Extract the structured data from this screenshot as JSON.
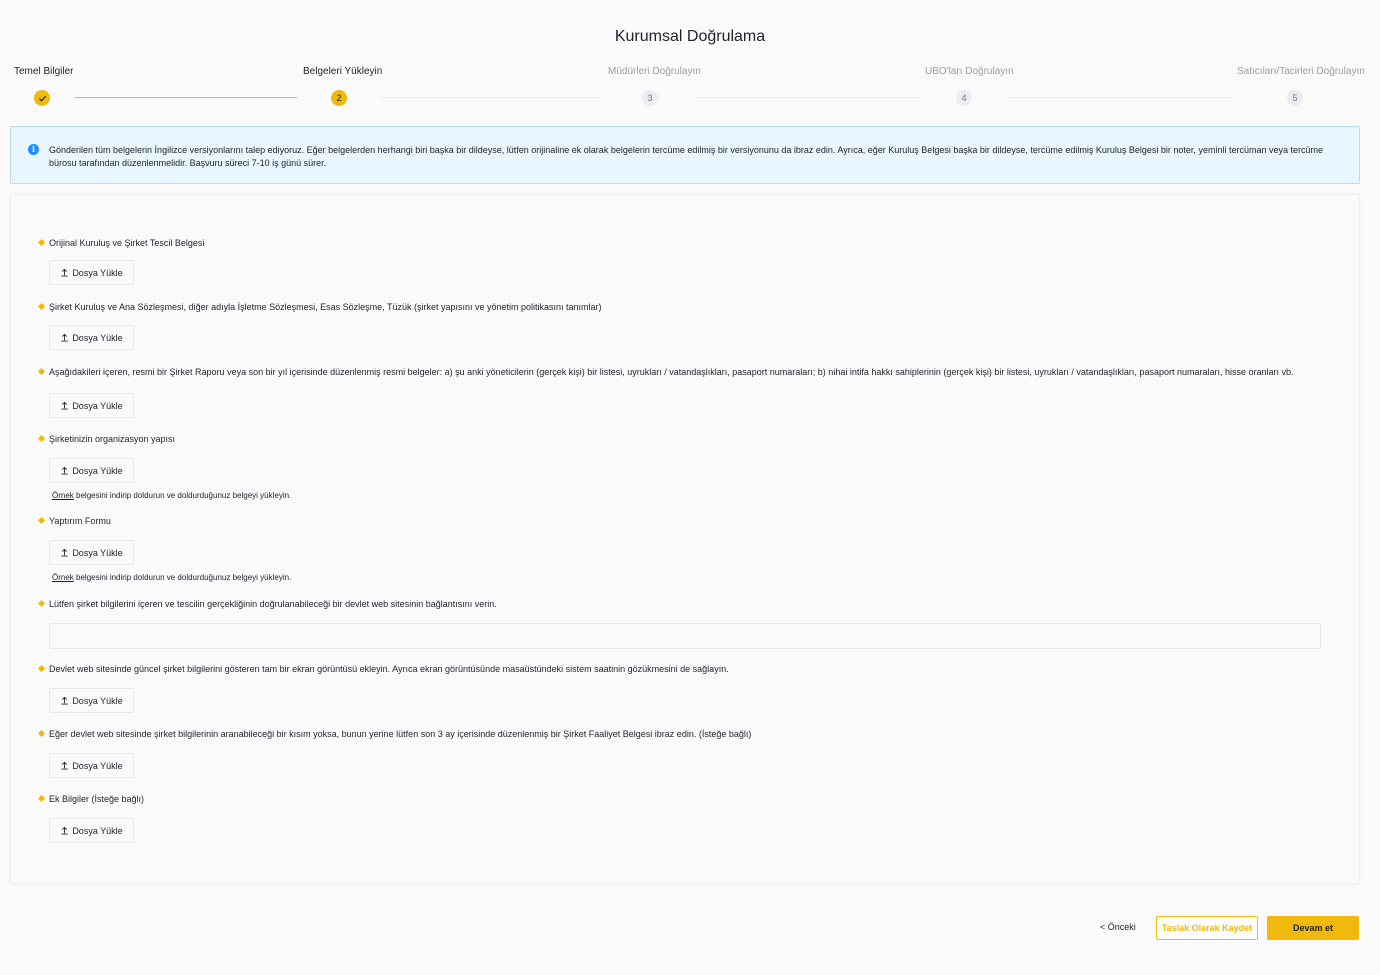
{
  "page": {
    "title": "Kurumsal Doğrulama"
  },
  "stepper": {
    "steps": [
      {
        "label": "Temel Bilgiler",
        "number": "✓"
      },
      {
        "label": "Belgeleri Yükleyin",
        "number": "2"
      },
      {
        "label": "Müdürleri Doğrulayın",
        "number": "3"
      },
      {
        "label": "UBO'ları Doğrulayın",
        "number": "4"
      },
      {
        "label": "Satıcıları/Tacirleri Doğrulayın",
        "number": "5"
      }
    ]
  },
  "info": {
    "icon": "info-icon",
    "text": "Gönderilen tüm belgelerin İngilizce versiyonlarını talep ediyoruz. Eğer belgelerden herhangi biri başka bir dildeyse, lütfen orijinaline ek olarak belgelerin tercüme edilmiş bir versiyonunu da ibraz edin. Ayrıca, eğer Kuruluş Belgesi başka bir dildeyse, tercüme edilmiş Kuruluş Belgesi bir noter, yeminli tercüman veya tercüme bürosu tarafından düzenlenmelidir. Başvuru süreci 7-10 iş günü sürer."
  },
  "upload_label": "Dosya Yükle",
  "hint": {
    "link": "Örnek",
    "text": " belgesini indirip doldurun ve doldurduğunuz belgeyi yükleyin."
  },
  "questions": [
    "Orijinal Kuruluş ve Şirket Tescil Belgesi",
    "Şirket Kuruluş ve Ana Sözleşmesi, diğer adıyla İşletme Sözleşmesi, Esas Sözleşme, Tüzük (şirket yapısını ve yönetim politikasını tanımlar)",
    "Aşağıdakileri içeren, resmi bir Şirket Raporu veya son bir yıl içerisinde düzenlenmiş resmi belgeler: a) şu anki yöneticilerin (gerçek kişi) bir listesi, uyrukları / vatandaşlıkları, pasaport numaraları; b) nihai intifa hakkı sahiplerinin (gerçek kişi) bir listesi, uyrukları / vatandaşlıkları, pasaport numaraları, hisse oranları vb.",
    "Şirketinizin organizasyon yapısı",
    "Yaptırım Formu",
    "Lütfen şirket bilgilerini içeren ve tescilin gerçekliğinin doğrulanabileceği bir devlet web sitesinin bağlantısını verin.",
    "Devlet web sitesinde güncel şirket bilgilerini gösteren tam bir ekran görüntüsü ekleyin. Ayrıca ekran görüntüsünde masaüstündeki sistem saatinin gözükmesini de sağlayın.",
    "Eğer devlet web sitesinde şirket bilgilerinin aranabileceği bir kısım yoksa, bunun yerine lütfen son 3 ay içerisinde düzenlenmiş bir Şirket Faaliyet Belgesi ibraz edin. (İsteğe bağlı)",
    "Ek Bilgiler (İsteğe bağlı)"
  ],
  "url_input": {
    "value": "",
    "placeholder": ""
  },
  "footer": {
    "prev": "< Önceki",
    "draft": "Taslak Olarak Kaydet",
    "next": "Devam et"
  },
  "colors": {
    "accent": "#f0b90b",
    "info_bg": "#eaf6ff",
    "info_icon": "#1890ff"
  }
}
